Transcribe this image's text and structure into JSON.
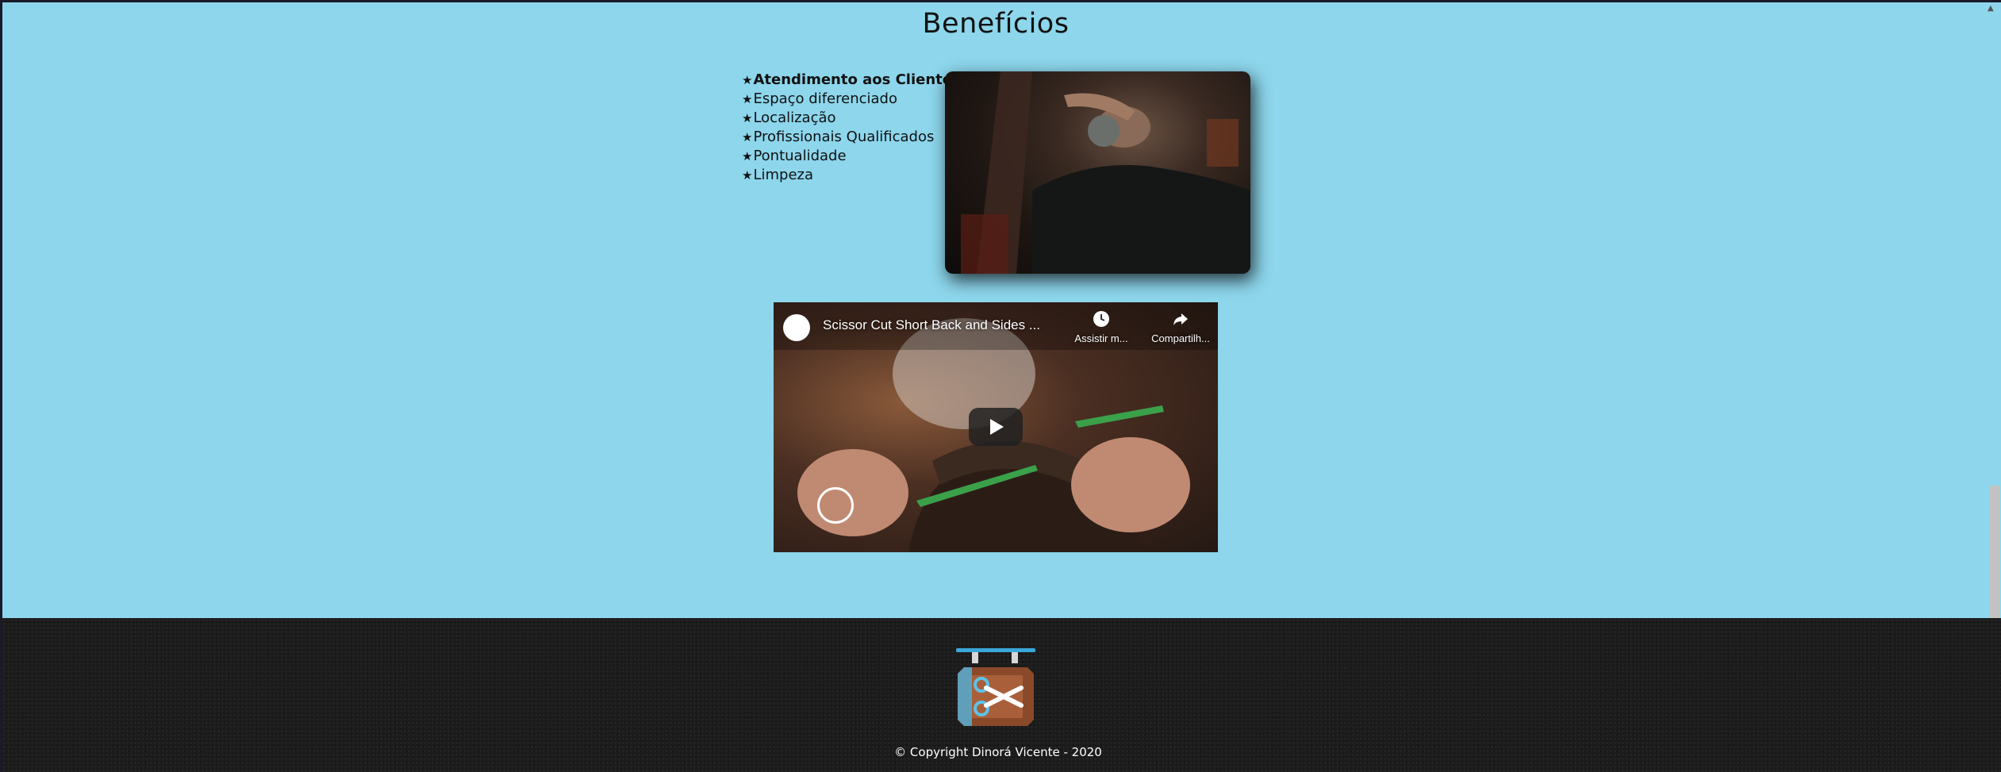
{
  "section": {
    "title": "Benefícios"
  },
  "benefits": [
    {
      "icon": "star-icon",
      "label": "Atendimento aos Clientes"
    },
    {
      "icon": "star-icon",
      "label": "Espaço diferenciado"
    },
    {
      "icon": "star-icon",
      "label": "Localização"
    },
    {
      "icon": "star-icon",
      "label": "Profissionais Qualificados"
    },
    {
      "icon": "star-icon",
      "label": "Pontualidade"
    },
    {
      "icon": "star-icon",
      "label": "Limpeza"
    }
  ],
  "video": {
    "title": "Scissor Cut Short Back and Sides ...",
    "watch_later_label": "Assistir m...",
    "share_label": "Compartilh...",
    "play_icon": "play-icon"
  },
  "footer": {
    "logo_icon": "barbershop-sign-icon",
    "copyright": "© Copyright Dinorá Vicente - 2020"
  },
  "colors": {
    "page_background": "#8dd6ec",
    "footer_background": "#1b1b1b",
    "logo_blue": "#3aa7d8",
    "logo_brown": "#8a4a2a"
  }
}
